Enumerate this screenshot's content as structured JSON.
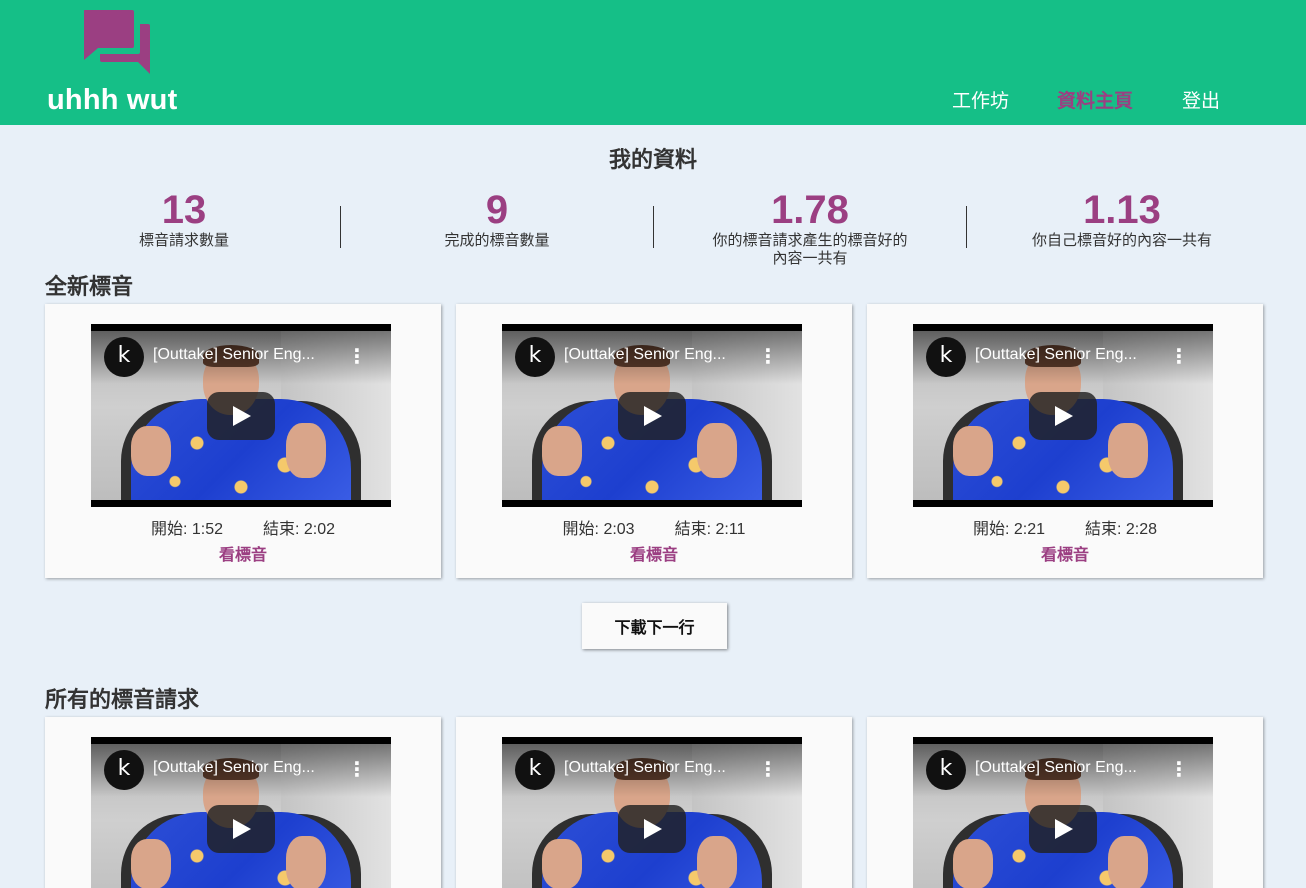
{
  "brand": {
    "name": "uhhh wut",
    "logo_color": "#9b3f82"
  },
  "nav": [
    {
      "label": "工作坊",
      "active": false
    },
    {
      "label": "資料主頁",
      "active": true
    },
    {
      "label": "登出",
      "active": false
    }
  ],
  "colors": {
    "header": "#15bf87",
    "accent": "#9b3f82",
    "background": "#e8f0f8"
  },
  "profile": {
    "title": "我的資料",
    "stats": [
      {
        "value": "13",
        "label": "標音請求數量"
      },
      {
        "value": "9",
        "label": "完成的標音數量"
      },
      {
        "value": "1.78",
        "label": "你的標音請求產生的標音好的內容一共有"
      },
      {
        "value": "1.13",
        "label": "你自己標音好的內容一共有"
      }
    ]
  },
  "new_captions": {
    "title": "全新標音",
    "cards": [
      {
        "video_title": "[Outtake] Senior Eng...",
        "channel_initial": "k",
        "start": "開始: 1:52",
        "end": "結束: 2:02",
        "link": "看標音"
      },
      {
        "video_title": "[Outtake] Senior Eng...",
        "channel_initial": "k",
        "start": "開始: 2:03",
        "end": "結束: 2:11",
        "link": "看標音"
      },
      {
        "video_title": "[Outtake] Senior Eng...",
        "channel_initial": "k",
        "start": "開始: 2:21",
        "end": "結束: 2:28",
        "link": "看標音"
      }
    ],
    "load_more": "下載下一行"
  },
  "all_requests": {
    "title": "所有的標音請求",
    "cards": [
      {
        "video_title": "[Outtake] Senior Eng...",
        "channel_initial": "k"
      },
      {
        "video_title": "[Outtake] Senior Eng...",
        "channel_initial": "k"
      },
      {
        "video_title": "[Outtake] Senior Eng...",
        "channel_initial": "k"
      }
    ]
  }
}
